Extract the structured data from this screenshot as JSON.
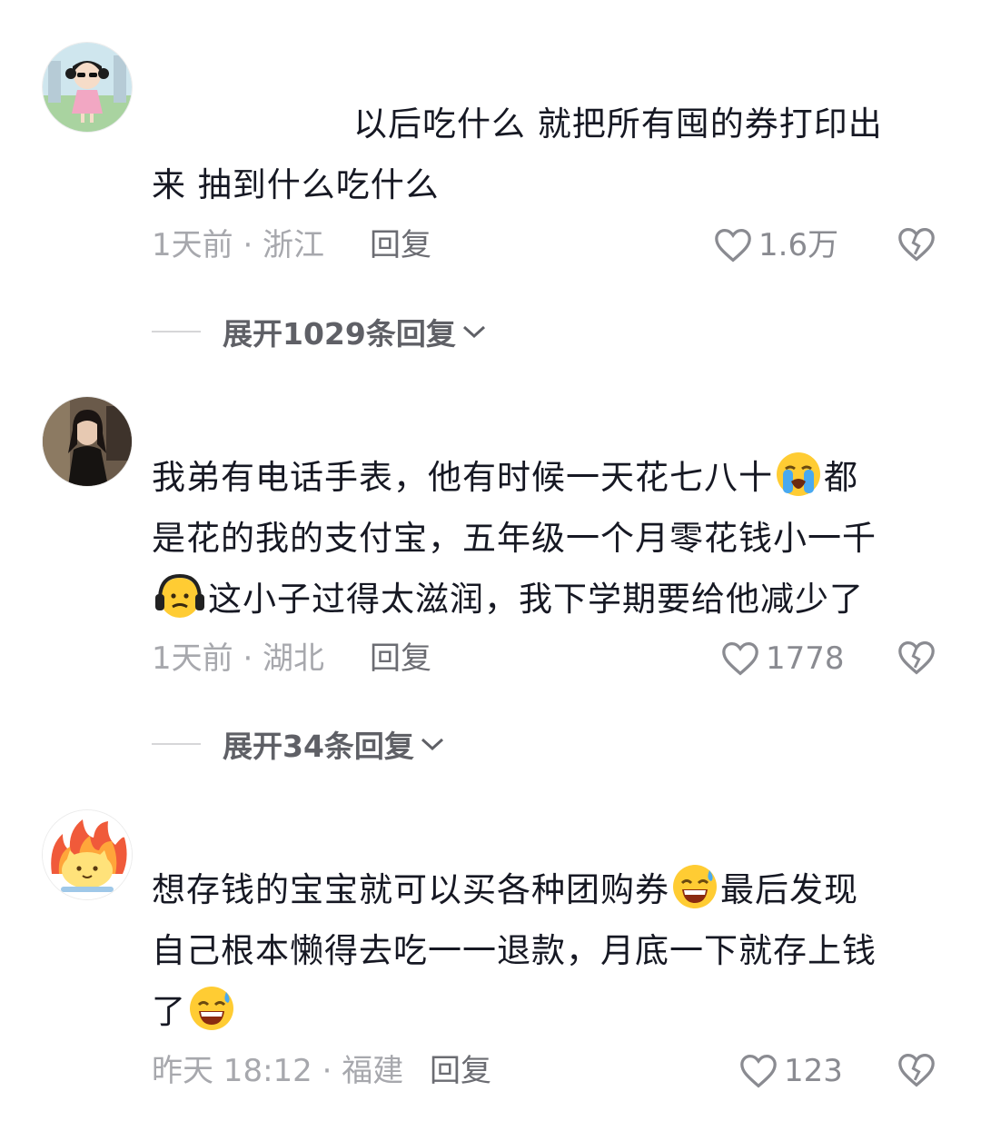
{
  "comments": [
    {
      "lines": [
        "以后吃什么 就把所有囤的券打印出",
        "来 抽到什么吃什么"
      ],
      "time": "1天前 · 浙江",
      "reply": "回复",
      "likes": "1.6万",
      "expand": "展开1029条回复"
    },
    {
      "lines": [
        "我弟有电话手表，他有时候一天花七八十",
        "都",
        "是花的我的支付宝，五年级一个月零花钱小一千",
        "这小子过得太滋润，我下学期要给他减少了"
      ],
      "time": "1天前 · 湖北",
      "reply": "回复",
      "likes": "1778",
      "expand": "展开34条回复"
    },
    {
      "lines": [
        "想存钱的宝宝就可以买各种团购券",
        "最后发现",
        "自己根本懒得去吃一一退款，月底一下就存上钱",
        "了"
      ],
      "time": "昨天 18:12 · 福建",
      "reply": "回复",
      "likes": "123"
    }
  ],
  "icons": {
    "like": "heart-outline-icon",
    "dislike": "broken-heart-icon",
    "expand": "chevron-down-icon",
    "emoji_crying": "loudly-crying-face-emoji",
    "emoji_headphones": "headphones-face-emoji",
    "emoji_grin": "grinning-sweat-face-emoji"
  },
  "colors": {
    "text": "#161823",
    "meta": "#a7a8ad",
    "reply": "#6b6c72",
    "icon": "#8a8b91"
  }
}
